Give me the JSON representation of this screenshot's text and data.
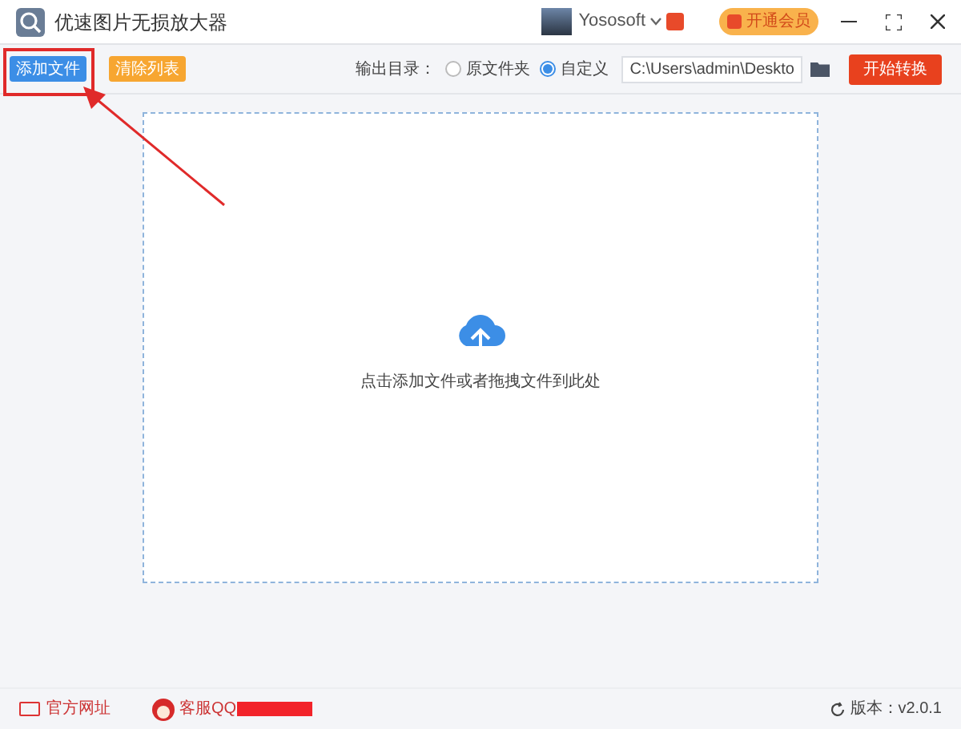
{
  "window": {
    "title": "优速图片无损放大器",
    "user": "Yososoft",
    "vip_button": "开通会员"
  },
  "toolbar": {
    "add_button": "添加文件",
    "clear_button": "清除列表",
    "output_label": "输出目录：",
    "output_options": [
      {
        "label": "原文件夹",
        "selected": false
      },
      {
        "label": "自定义",
        "selected": true
      }
    ],
    "path": "C:\\Users\\admin\\Deskto",
    "start_button": "开始转换"
  },
  "drop_zone": {
    "hint": "点击添加文件或者拖拽文件到此处"
  },
  "annotation": {
    "highlight": true
  },
  "footer": {
    "website": "官方网址",
    "support": "客服QQ",
    "version": "版本：v2.0.1"
  }
}
